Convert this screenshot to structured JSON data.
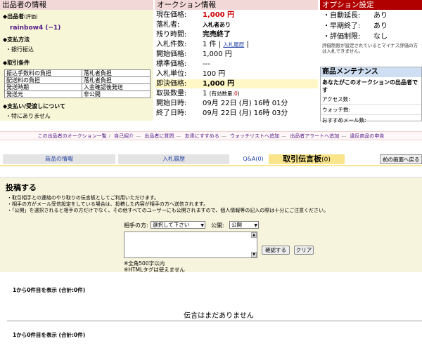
{
  "seller": {
    "title": "出品者の情報",
    "seller_label": "◆出品者",
    "rating_label": "(評価)",
    "name": "rainbow4",
    "rating": "(−1)",
    "payment_title": "◆支払方法",
    "payment_method": "・銀行振込",
    "terms_title": "◆取引条件",
    "terms": [
      [
        "振込手数料の負担",
        "落札者負担"
      ],
      [
        "配送料の負担",
        "落札者負担"
      ],
      [
        "発送時期",
        "入金確認後発送"
      ],
      [
        "発送元",
        "非公開"
      ]
    ],
    "restrictions_title": "◆支払い/受渡しについて",
    "restrictions": "・特にありません"
  },
  "auction": {
    "title": "オークション情報",
    "current_price_label": "現在価格:",
    "current_price": "1,000 円",
    "winner_label": "落札者:",
    "winner": "入札者あり",
    "remaining_label": "残り時間:",
    "remaining": "完売終了",
    "bids_label": "入札件数:",
    "bids_count": "1 件",
    "bid_history_link": "入札履歴",
    "start_price_label": "開始価格:",
    "start_price": "1,000 円",
    "standard_price_label": "標準価格:",
    "standard_price": "---",
    "bid_unit_label": "入札単位:",
    "bid_unit": "100 円",
    "buyout_label": "即決価格:",
    "buyout_price": "1,000 円",
    "quantity_label": "取扱数量:",
    "quantity": "1",
    "valid_bids_label": "(有効数量:",
    "valid_bids": "0",
    "start_date_label": "開始日時:",
    "start_date": "09月 22日 (月) 16時 01分",
    "end_date_label": "終了日時:",
    "end_date": "09月 22日 (月) 16時 03分"
  },
  "options": {
    "title": "オプション設定",
    "auto_extend_label": "・自動延長:",
    "auto_extend": "あり",
    "early_end_label": "・早期終了:",
    "early_end": "あり",
    "rating_limit_label": "・評価制限:",
    "rating_limit": "なし",
    "note": "評価制限が設定されているとマイナス評価の方は入札できません。"
  },
  "maintenance": {
    "title": "商品メンテナンス",
    "subtitle": "あなたがこのオークションの出品者です",
    "access_label": "アクセス数:",
    "watch_label": "ウォッチ数:",
    "recommend_label": "おすすめメール数:"
  },
  "links": [
    "この出品者のオークション一覧",
    "自己紹介",
    "出品者に質問",
    "友達にすすめる",
    "ウォッチリストへ追加",
    "出品者アラートへ追加",
    "違反商品の申告"
  ],
  "tabs": {
    "goods": "商品の情報",
    "bids": "入札履歴",
    "qa": "Q&A(0)",
    "board": "取引伝言板",
    "board_count": "(0)",
    "prev": "前の画面へ戻る"
  },
  "post": {
    "title": "投稿する",
    "notes": [
      "・取引相手との連絡のやり取りの伝言板としてご利用いただけます。",
      "・相手の方がメール受信設定をしている場合は、投稿した内容が相手の方へ送信されます。",
      "・「公開」を選択されると相手の方だけでなく、その他すべてのユーザーにも公開されますので、個人情報等の記入の際は十分にご注意ください。"
    ],
    "recipient_label": "相手の方:",
    "recipient_value": "選択して下さい",
    "public_label": "公開:",
    "public_value": "公開",
    "confirm_button": "確認する",
    "clear_button": "クリア",
    "hint1": "※全角500字以内",
    "hint2": "※HTMLタグは使えません"
  },
  "results": {
    "count_top": "1から0件目を表示 (合計:0件)",
    "empty_message": "伝言はまだありません",
    "count_bottom": "1から0件目を表示 (合計:0件)"
  }
}
